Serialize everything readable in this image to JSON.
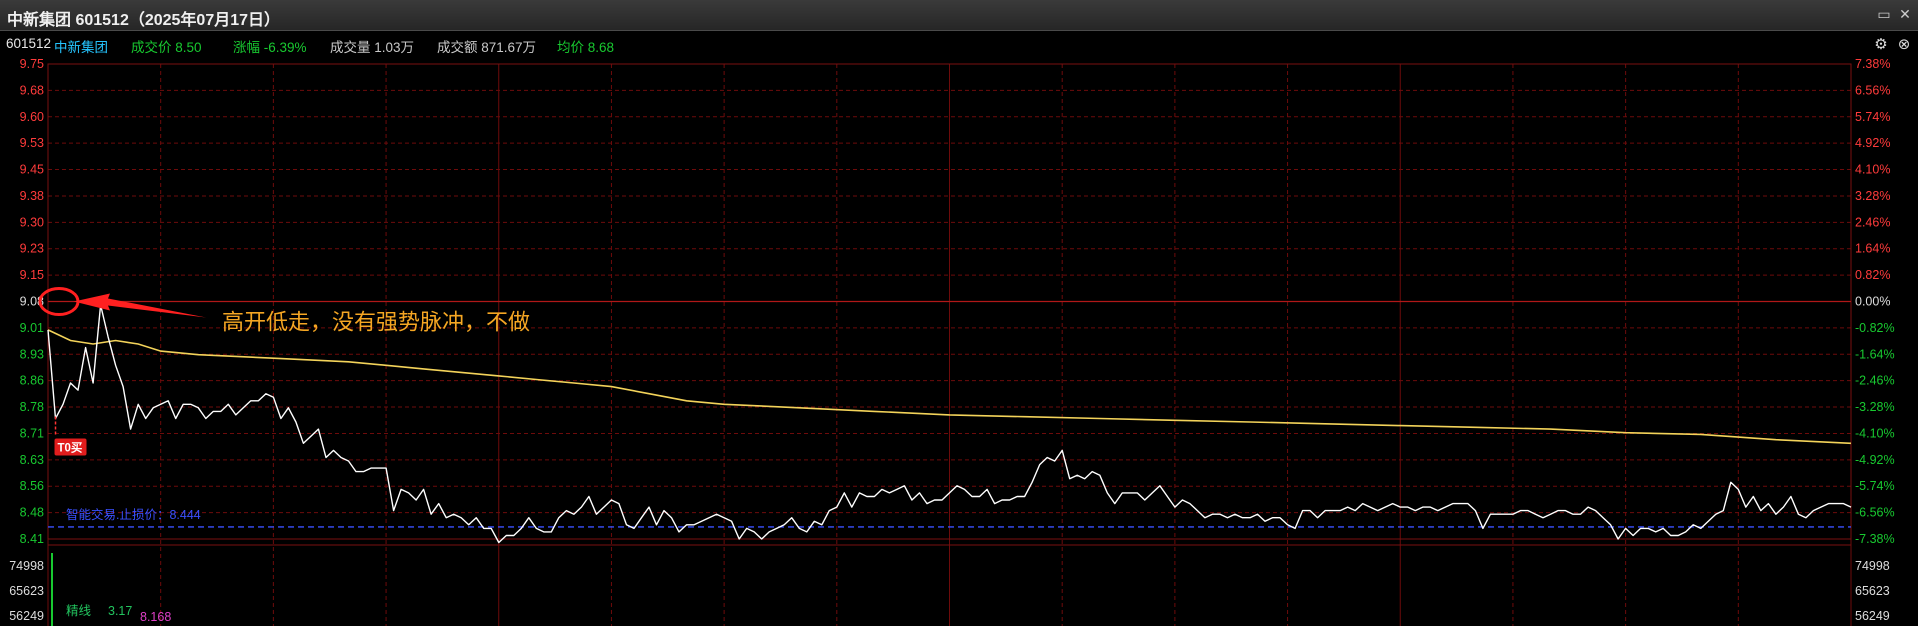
{
  "window": {
    "title": "中新集团 601512（2025年07月17日）",
    "restore_icon": "restore-window-icon",
    "close_icon": "close-icon"
  },
  "info_bar": {
    "code": "601512",
    "name": "中新集团",
    "price_label": "成交价 8.50",
    "change_label": "涨幅 -6.39%",
    "volume_label": "成交量 1.03万",
    "amount_label": "成交额 871.67万",
    "avg_label": "均价 8.68",
    "settings_icon": "gear-icon",
    "close_icon": "close-circle-icon"
  },
  "colors": {
    "up": "#ff3b3b",
    "down": "#18c930",
    "price_line": "#ffffff",
    "avg_line": "#f3d35a",
    "grid": "#6e0b0b",
    "annotation": "#ff2020",
    "annotation_text": "#f5a623",
    "stop_line": "#3a50ff"
  },
  "chart_data": {
    "type": "line",
    "title": "",
    "ylim": [
      8.41,
      9.75
    ],
    "prev_close": 9.08,
    "left_ticks": [
      "9.75",
      "9.68",
      "9.60",
      "9.53",
      "9.45",
      "9.38",
      "9.30",
      "9.23",
      "9.15",
      "9.08",
      "9.01",
      "8.93",
      "8.86",
      "8.78",
      "8.71",
      "8.63",
      "8.56",
      "8.48",
      "8.41"
    ],
    "right_ticks": [
      "7.38%",
      "6.56%",
      "5.74%",
      "4.92%",
      "4.10%",
      "3.28%",
      "2.46%",
      "1.64%",
      "0.82%",
      "0.00%",
      "-0.82%",
      "-1.64%",
      "-2.46%",
      "-3.28%",
      "-4.10%",
      "-4.92%",
      "-5.74%",
      "-6.56%",
      "-7.38%"
    ],
    "x": [
      0,
      3,
      6,
      9,
      12,
      15,
      18,
      21,
      24,
      27,
      30,
      36,
      45,
      60,
      75,
      90,
      105,
      120,
      135,
      150,
      165,
      180,
      195,
      210,
      225,
      240
    ],
    "series": [
      {
        "values": [
          9.0,
          8.76,
          8.79,
          8.84,
          8.82,
          8.9,
          8.83,
          9.06,
          8.95,
          8.85,
          8.72,
          8.78,
          8.74,
          8.8,
          8.62,
          8.46,
          8.43,
          8.46,
          8.45,
          8.46,
          8.48,
          8.5,
          8.49,
          8.46,
          8.44,
          8.48
        ],
        "points": [
          [
            0,
            9.0
          ],
          [
            1,
            8.75
          ],
          [
            2,
            8.79
          ],
          [
            3,
            8.85
          ],
          [
            4,
            8.83
          ],
          [
            5,
            8.95
          ],
          [
            6,
            8.85
          ],
          [
            7,
            9.07
          ],
          [
            8,
            8.98
          ],
          [
            9,
            8.9
          ],
          [
            10,
            8.84
          ],
          [
            11,
            8.72
          ],
          [
            12,
            8.79
          ],
          [
            13,
            8.75
          ],
          [
            14,
            8.78
          ],
          [
            15,
            8.79
          ],
          [
            16,
            8.8
          ],
          [
            17,
            8.75
          ],
          [
            18,
            8.79
          ],
          [
            19,
            8.79
          ],
          [
            20,
            8.78
          ],
          [
            21,
            8.75
          ],
          [
            22,
            8.77
          ],
          [
            23,
            8.77
          ],
          [
            24,
            8.79
          ],
          [
            25,
            8.76
          ],
          [
            26,
            8.78
          ],
          [
            27,
            8.8
          ],
          [
            28,
            8.8
          ],
          [
            29,
            8.82
          ],
          [
            30,
            8.81
          ],
          [
            31,
            8.75
          ],
          [
            32,
            8.78
          ],
          [
            33,
            8.74
          ],
          [
            34,
            8.68
          ],
          [
            35,
            8.7
          ],
          [
            36,
            8.72
          ],
          [
            37,
            8.64
          ],
          [
            38,
            8.66
          ],
          [
            39,
            8.64
          ],
          [
            40,
            8.63
          ],
          [
            41,
            8.6
          ],
          [
            42,
            8.6
          ],
          [
            43,
            8.61
          ],
          [
            44,
            8.61
          ],
          [
            45,
            8.61
          ],
          [
            46,
            8.49
          ],
          [
            47,
            8.55
          ],
          [
            48,
            8.54
          ],
          [
            49,
            8.52
          ],
          [
            50,
            8.55
          ],
          [
            51,
            8.48
          ],
          [
            52,
            8.51
          ],
          [
            53,
            8.47
          ],
          [
            54,
            8.48
          ],
          [
            55,
            8.47
          ],
          [
            56,
            8.45
          ],
          [
            57,
            8.47
          ],
          [
            58,
            8.44
          ],
          [
            59,
            8.44
          ],
          [
            60,
            8.4
          ],
          [
            61,
            8.42
          ],
          [
            62,
            8.42
          ],
          [
            63,
            8.44
          ],
          [
            64,
            8.47
          ],
          [
            65,
            8.44
          ],
          [
            66,
            8.43
          ],
          [
            67,
            8.43
          ],
          [
            68,
            8.47
          ],
          [
            69,
            8.49
          ],
          [
            70,
            8.48
          ],
          [
            71,
            8.5
          ],
          [
            72,
            8.53
          ],
          [
            73,
            8.48
          ],
          [
            74,
            8.5
          ],
          [
            75,
            8.52
          ],
          [
            76,
            8.51
          ],
          [
            77,
            8.45
          ],
          [
            78,
            8.44
          ],
          [
            79,
            8.47
          ],
          [
            80,
            8.5
          ],
          [
            81,
            8.45
          ],
          [
            82,
            8.49
          ],
          [
            83,
            8.47
          ],
          [
            84,
            8.43
          ],
          [
            85,
            8.45
          ],
          [
            86,
            8.45
          ],
          [
            87,
            8.46
          ],
          [
            88,
            8.47
          ],
          [
            89,
            8.48
          ],
          [
            90,
            8.47
          ],
          [
            91,
            8.46
          ],
          [
            92,
            8.41
          ],
          [
            93,
            8.44
          ],
          [
            94,
            8.43
          ],
          [
            95,
            8.41
          ],
          [
            96,
            8.43
          ],
          [
            97,
            8.44
          ],
          [
            98,
            8.45
          ],
          [
            99,
            8.47
          ],
          [
            100,
            8.44
          ],
          [
            101,
            8.43
          ],
          [
            102,
            8.46
          ],
          [
            103,
            8.45
          ],
          [
            104,
            8.49
          ],
          [
            105,
            8.5
          ],
          [
            106,
            8.54
          ],
          [
            107,
            8.5
          ],
          [
            108,
            8.54
          ],
          [
            109,
            8.53
          ],
          [
            110,
            8.53
          ],
          [
            111,
            8.55
          ],
          [
            112,
            8.54
          ],
          [
            113,
            8.55
          ],
          [
            114,
            8.56
          ],
          [
            115,
            8.52
          ],
          [
            116,
            8.54
          ],
          [
            117,
            8.51
          ],
          [
            118,
            8.52
          ],
          [
            119,
            8.52
          ],
          [
            120,
            8.54
          ],
          [
            121,
            8.56
          ],
          [
            122,
            8.55
          ],
          [
            123,
            8.53
          ],
          [
            124,
            8.53
          ],
          [
            125,
            8.55
          ],
          [
            126,
            8.51
          ],
          [
            127,
            8.52
          ],
          [
            128,
            8.52
          ],
          [
            129,
            8.53
          ],
          [
            130,
            8.53
          ],
          [
            131,
            8.57
          ],
          [
            132,
            8.62
          ],
          [
            133,
            8.64
          ],
          [
            134,
            8.63
          ],
          [
            135,
            8.66
          ],
          [
            136,
            8.58
          ],
          [
            137,
            8.59
          ],
          [
            138,
            8.58
          ],
          [
            139,
            8.6
          ],
          [
            140,
            8.59
          ],
          [
            141,
            8.54
          ],
          [
            142,
            8.51
          ],
          [
            143,
            8.54
          ],
          [
            144,
            8.54
          ],
          [
            145,
            8.54
          ],
          [
            146,
            8.52
          ],
          [
            147,
            8.54
          ],
          [
            148,
            8.56
          ],
          [
            149,
            8.53
          ],
          [
            150,
            8.5
          ],
          [
            151,
            8.52
          ],
          [
            152,
            8.51
          ],
          [
            153,
            8.49
          ],
          [
            154,
            8.47
          ],
          [
            155,
            8.48
          ],
          [
            156,
            8.48
          ],
          [
            157,
            8.47
          ],
          [
            158,
            8.48
          ],
          [
            159,
            8.47
          ],
          [
            160,
            8.47
          ],
          [
            161,
            8.48
          ],
          [
            162,
            8.46
          ],
          [
            163,
            8.47
          ],
          [
            164,
            8.47
          ],
          [
            165,
            8.45
          ],
          [
            166,
            8.44
          ],
          [
            167,
            8.49
          ],
          [
            168,
            8.49
          ],
          [
            169,
            8.47
          ],
          [
            170,
            8.49
          ],
          [
            171,
            8.49
          ],
          [
            172,
            8.49
          ],
          [
            173,
            8.5
          ],
          [
            174,
            8.49
          ],
          [
            175,
            8.51
          ],
          [
            176,
            8.5
          ],
          [
            177,
            8.49
          ],
          [
            178,
            8.5
          ],
          [
            179,
            8.51
          ],
          [
            180,
            8.5
          ],
          [
            181,
            8.5
          ],
          [
            182,
            8.49
          ],
          [
            183,
            8.5
          ],
          [
            184,
            8.5
          ],
          [
            185,
            8.49
          ],
          [
            186,
            8.5
          ],
          [
            187,
            8.51
          ],
          [
            188,
            8.51
          ],
          [
            189,
            8.51
          ],
          [
            190,
            8.49
          ],
          [
            191,
            8.44
          ],
          [
            192,
            8.48
          ],
          [
            193,
            8.48
          ],
          [
            194,
            8.48
          ],
          [
            195,
            8.48
          ],
          [
            196,
            8.49
          ],
          [
            197,
            8.49
          ],
          [
            198,
            8.48
          ],
          [
            199,
            8.47
          ],
          [
            200,
            8.48
          ],
          [
            201,
            8.49
          ],
          [
            202,
            8.49
          ],
          [
            203,
            8.48
          ],
          [
            204,
            8.48
          ],
          [
            205,
            8.5
          ],
          [
            206,
            8.49
          ],
          [
            207,
            8.47
          ],
          [
            208,
            8.45
          ],
          [
            209,
            8.41
          ],
          [
            210,
            8.44
          ],
          [
            211,
            8.42
          ],
          [
            212,
            8.44
          ],
          [
            213,
            8.44
          ],
          [
            214,
            8.43
          ],
          [
            215,
            8.44
          ],
          [
            216,
            8.42
          ],
          [
            217,
            8.42
          ],
          [
            218,
            8.43
          ],
          [
            219,
            8.45
          ],
          [
            220,
            8.44
          ],
          [
            221,
            8.46
          ],
          [
            222,
            8.48
          ],
          [
            223,
            8.49
          ],
          [
            224,
            8.57
          ],
          [
            225,
            8.55
          ],
          [
            226,
            8.5
          ],
          [
            227,
            8.53
          ],
          [
            228,
            8.49
          ],
          [
            229,
            8.51
          ],
          [
            230,
            8.48
          ],
          [
            231,
            8.5
          ],
          [
            232,
            8.53
          ],
          [
            233,
            8.48
          ],
          [
            234,
            8.47
          ],
          [
            235,
            8.49
          ],
          [
            236,
            8.5
          ],
          [
            237,
            8.51
          ],
          [
            238,
            8.51
          ],
          [
            239,
            8.51
          ],
          [
            240,
            8.5
          ]
        ]
      },
      {
        "points": [
          [
            0,
            9.0
          ],
          [
            3,
            8.97
          ],
          [
            6,
            8.96
          ],
          [
            9,
            8.97
          ],
          [
            12,
            8.96
          ],
          [
            15,
            8.94
          ],
          [
            20,
            8.93
          ],
          [
            30,
            8.92
          ],
          [
            40,
            8.91
          ],
          [
            45,
            8.9
          ],
          [
            50,
            8.89
          ],
          [
            55,
            8.88
          ],
          [
            60,
            8.87
          ],
          [
            65,
            8.86
          ],
          [
            70,
            8.85
          ],
          [
            75,
            8.84
          ],
          [
            80,
            8.82
          ],
          [
            85,
            8.8
          ],
          [
            90,
            8.79
          ],
          [
            100,
            8.78
          ],
          [
            110,
            8.77
          ],
          [
            120,
            8.76
          ],
          [
            130,
            8.755
          ],
          [
            140,
            8.75
          ],
          [
            150,
            8.745
          ],
          [
            160,
            8.74
          ],
          [
            170,
            8.735
          ],
          [
            180,
            8.73
          ],
          [
            190,
            8.725
          ],
          [
            200,
            8.72
          ],
          [
            210,
            8.71
          ],
          [
            220,
            8.705
          ],
          [
            230,
            8.69
          ],
          [
            240,
            8.68
          ]
        ]
      }
    ],
    "stop_loss": 8.444,
    "stop_loss_label": "智能交易.止损价：8.444",
    "annotation_text": "高开低走，没有强势脉冲，不做",
    "buy_marker_label": "T0买",
    "buy_marker_x": 1,
    "buy_marker_price": 8.75,
    "volume_ticks": [
      "74998",
      "65623",
      "56249"
    ],
    "volume_overlay_labels": [
      "精线",
      "3.17",
      "8.168"
    ]
  }
}
